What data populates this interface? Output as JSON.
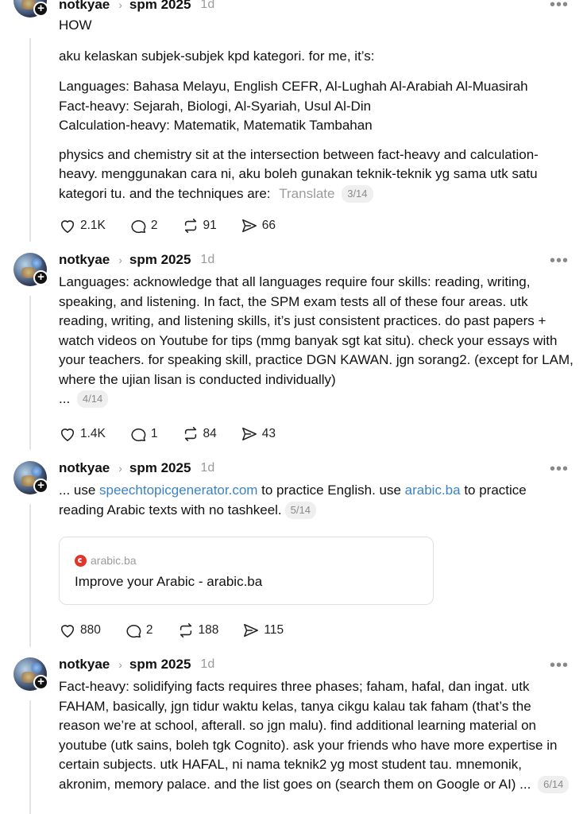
{
  "icons": {
    "like": "heart-icon",
    "reply": "comment-icon",
    "repost": "repost-icon",
    "share": "send-icon",
    "more": "more-icon",
    "follow": "plus-icon"
  },
  "posts": [
    {
      "username": "notkyae",
      "topic": "spm 2025",
      "time": "1d",
      "paragraphs": [
        "HOW",
        "aku kelaskan subjek-subjek kpd kategori. for me, it’s:",
        "Languages: Bahasa Melayu, English CEFR, Al-Lughah Al-Arabiah Al-Muasirah",
        "Fact-heavy: Sejarah, Biologi, Al-Syariah, Usul Al-Din",
        "Calculation-heavy: Matematik, Matematik Tambahan",
        "physics and chemistry sit at the intersection between fact-heavy and calculation-heavy. menggunakan cara ni, aku boleh gunakan teknik-teknik yg sama utk satu kategori tu. and the techniques are:"
      ],
      "translate": "Translate",
      "pager": "3/14",
      "likes": "2.1K",
      "replies": "2",
      "reposts": "91",
      "shares": "66"
    },
    {
      "username": "notkyae",
      "topic": "spm 2025",
      "time": "1d",
      "text": "Languages: acknowledge that all languages require four skills: reading, writing, speaking, and listening. In fact, the SPM exam tests all of these four areas. utk reading, writing, and listening skills, it’s just consistent practices. do past papers + watch videos on Youtube for tips (mmg banyak sgt kat situ). check your essays with your teachers. for speaking skill, practice DGN KAWAN. jgn sorang2. (except for LAM, where the ujian lisan is conducted individually)",
      "ellipsis": "...",
      "pager": "4/14",
      "likes": "1.4K",
      "replies": "1",
      "reposts": "84",
      "shares": "43"
    },
    {
      "username": "notkyae",
      "topic": "spm 2025",
      "time": "1d",
      "t1": "... use ",
      "link1": "speechtopicgenerator.com",
      "t2": " to practice English. use ",
      "link2": "arabic.ba",
      "t3": " to practice reading Arabic texts with no tashkeel.",
      "pager": "5/14",
      "card": {
        "domain": "arabic.ba",
        "title": "Improve your Arabic - arabic.ba"
      },
      "likes": "880",
      "replies": "2",
      "reposts": "188",
      "shares": "115"
    },
    {
      "username": "notkyae",
      "topic": "spm 2025",
      "time": "1d",
      "text": "Fact-heavy: solidifying facts requires three phases; faham, hafal, dan ingat. utk FAHAM, basically, jgn tidur waktu kelas, tanya cikgu kalau tak faham (that’s the reason we’re at school, afterall. so jgn malu). find additional learning material on youtube (utk sains, boleh tgk Cognito). ask your friends who have more expertise in certain subjects. utk HAFAL, ni nama teknik2 yg most student tau. mnemonik, akronim, memory palace. and the list goes on (search them on Google or AI) ...",
      "pager": "6/14"
    }
  ]
}
